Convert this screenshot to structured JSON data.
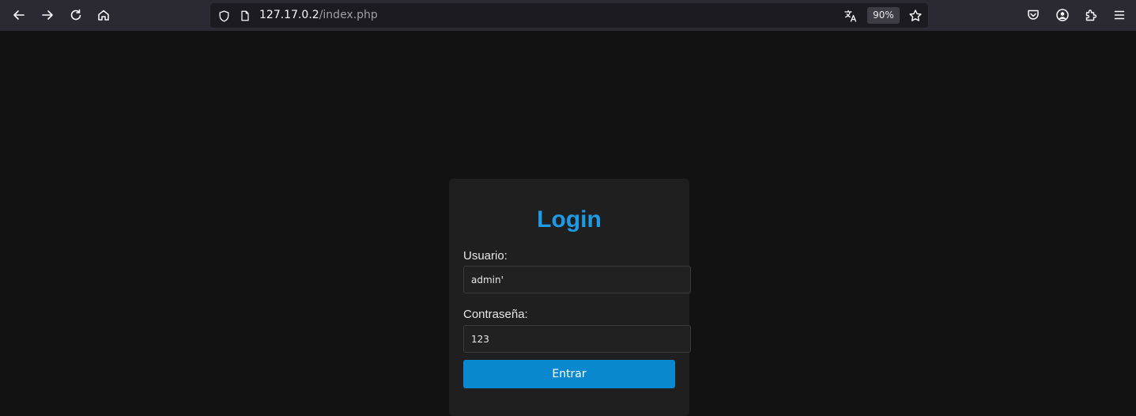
{
  "browser": {
    "url_host": "127.17.0.2",
    "url_path": "/index.php",
    "zoom": "90%",
    "icons": {
      "back": "back-arrow-icon",
      "forward": "forward-arrow-icon",
      "reload": "reload-icon",
      "home": "home-icon",
      "tracking_protection": "shield-icon",
      "page_info": "page-icon",
      "translate": "translate-icon",
      "bookmark": "star-icon",
      "pocket": "pocket-icon",
      "account": "account-icon",
      "extensions": "puzzle-icon",
      "menu": "hamburger-menu-icon"
    },
    "colors": {
      "toolbar_bg": "#2b2a33",
      "urlbar_bg": "#1c1b22",
      "icon": "#fbfbfe"
    }
  },
  "login": {
    "title": "Login",
    "username_label": "Usuario:",
    "username_value": "admin'",
    "password_label": "Contraseña:",
    "password_value": "123",
    "submit_label": "Entrar"
  },
  "colors": {
    "page_bg": "#121212",
    "card_bg": "#1f1f1f",
    "title": "#1e9be6",
    "button_bg": "#0a88cf"
  }
}
